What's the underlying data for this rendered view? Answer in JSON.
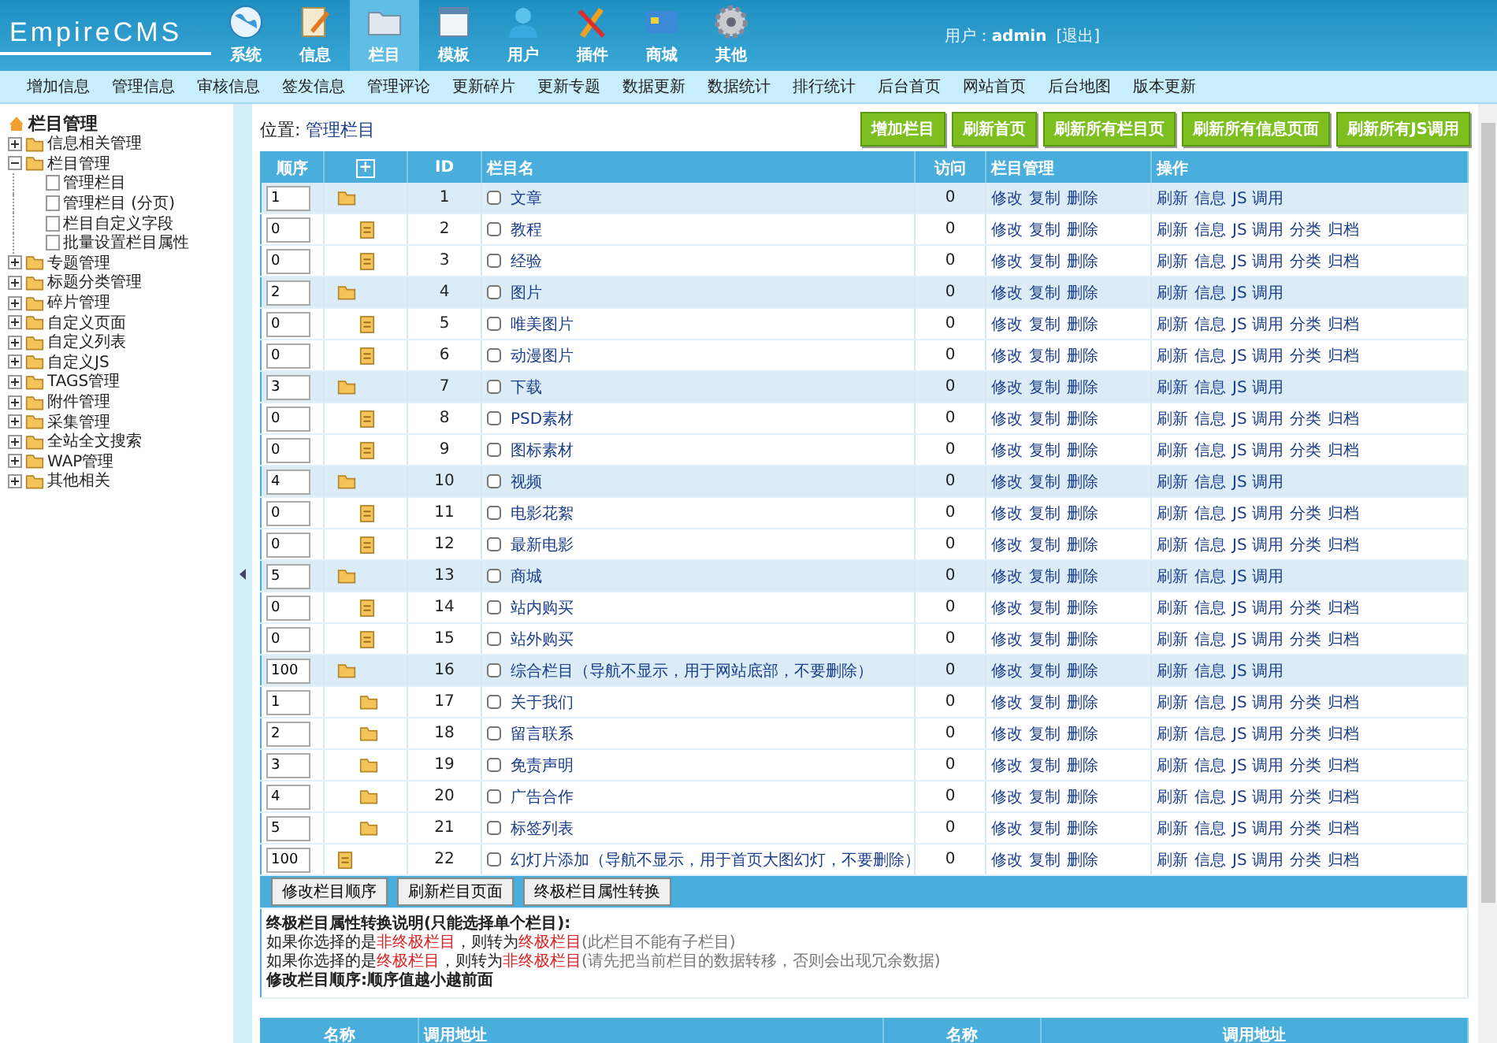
{
  "header": {
    "logo": "EmpireCMS",
    "nav": [
      {
        "label": "系统",
        "kind": "globe",
        "selected": false
      },
      {
        "label": "信息",
        "kind": "notepad",
        "selected": false
      },
      {
        "label": "栏目",
        "kind": "folder",
        "selected": true
      },
      {
        "label": "模板",
        "kind": "window",
        "selected": false
      },
      {
        "label": "用户",
        "kind": "user",
        "selected": false
      },
      {
        "label": "插件",
        "kind": "tools",
        "selected": false
      },
      {
        "label": "商城",
        "kind": "card",
        "selected": false
      },
      {
        "label": "其他",
        "kind": "gear",
        "selected": false
      }
    ],
    "user_label": "用户：",
    "user_name": "admin",
    "logout": "[退出]"
  },
  "menu": [
    "增加信息",
    "管理信息",
    "审核信息",
    "签发信息",
    "管理评论",
    "更新碎片",
    "更新专题",
    "数据更新",
    "数据统计",
    "排行统计",
    "后台首页",
    "网站首页",
    "后台地图",
    "版本更新"
  ],
  "sidebar": {
    "title": "栏目管理",
    "items": [
      {
        "label": "信息相关管理",
        "expanded": false
      },
      {
        "label": "栏目管理",
        "expanded": true,
        "children": [
          {
            "label": "管理栏目"
          },
          {
            "label": "管理栏目 (分页)"
          },
          {
            "label": "栏目自定义字段"
          },
          {
            "label": "批量设置栏目属性"
          }
        ]
      },
      {
        "label": "专题管理",
        "expanded": false
      },
      {
        "label": "标题分类管理",
        "expanded": false
      },
      {
        "label": "碎片管理",
        "expanded": false
      },
      {
        "label": "自定义页面",
        "expanded": false
      },
      {
        "label": "自定义列表",
        "expanded": false
      },
      {
        "label": "自定义JS",
        "expanded": false
      },
      {
        "label": "TAGS管理",
        "expanded": false
      },
      {
        "label": "附件管理",
        "expanded": false
      },
      {
        "label": "采集管理",
        "expanded": false
      },
      {
        "label": "全站全文搜索",
        "expanded": false
      },
      {
        "label": "WAP管理",
        "expanded": false
      },
      {
        "label": "其他相关",
        "expanded": false
      }
    ]
  },
  "breadcrumb": {
    "label": "位置:",
    "link": "管理栏目"
  },
  "toolbar": [
    "增加栏目",
    "刷新首页",
    "刷新所有栏目页",
    "刷新所有信息页面",
    "刷新所有JS调用"
  ],
  "table": {
    "columns": [
      "顺序",
      "+",
      "ID",
      "栏目名",
      "访问",
      "栏目管理",
      "操作"
    ],
    "rows": [
      {
        "order": "1",
        "kind": "folder",
        "id": "1",
        "checked": false,
        "name": "文章",
        "visits": "0",
        "manage": [
          "修改",
          "复制",
          "删除"
        ],
        "actions": [
          "刷新",
          "信息",
          "JS 调用"
        ]
      },
      {
        "order": "0",
        "kind": "doc",
        "id": "2",
        "checked": false,
        "name": "教程",
        "visits": "0",
        "manage": [
          "修改",
          "复制",
          "删除"
        ],
        "actions": [
          "刷新",
          "信息",
          "JS 调用",
          "分类",
          "归档"
        ]
      },
      {
        "order": "0",
        "kind": "doc",
        "id": "3",
        "checked": false,
        "name": "经验",
        "visits": "0",
        "manage": [
          "修改",
          "复制",
          "删除"
        ],
        "actions": [
          "刷新",
          "信息",
          "JS 调用",
          "分类",
          "归档"
        ]
      },
      {
        "order": "2",
        "kind": "folder",
        "id": "4",
        "checked": false,
        "name": "图片",
        "visits": "0",
        "manage": [
          "修改",
          "复制",
          "删除"
        ],
        "actions": [
          "刷新",
          "信息",
          "JS 调用"
        ]
      },
      {
        "order": "0",
        "kind": "doc",
        "id": "5",
        "checked": false,
        "name": "唯美图片",
        "visits": "0",
        "manage": [
          "修改",
          "复制",
          "删除"
        ],
        "actions": [
          "刷新",
          "信息",
          "JS 调用",
          "分类",
          "归档"
        ]
      },
      {
        "order": "0",
        "kind": "doc",
        "id": "6",
        "checked": false,
        "name": "动漫图片",
        "visits": "0",
        "manage": [
          "修改",
          "复制",
          "删除"
        ],
        "actions": [
          "刷新",
          "信息",
          "JS 调用",
          "分类",
          "归档"
        ]
      },
      {
        "order": "3",
        "kind": "folder",
        "id": "7",
        "checked": false,
        "name": "下载",
        "visits": "0",
        "manage": [
          "修改",
          "复制",
          "删除"
        ],
        "actions": [
          "刷新",
          "信息",
          "JS 调用"
        ]
      },
      {
        "order": "0",
        "kind": "doc",
        "id": "8",
        "checked": false,
        "name": "PSD素材",
        "visits": "0",
        "manage": [
          "修改",
          "复制",
          "删除"
        ],
        "actions": [
          "刷新",
          "信息",
          "JS 调用",
          "分类",
          "归档"
        ]
      },
      {
        "order": "0",
        "kind": "doc",
        "id": "9",
        "checked": false,
        "name": "图标素材",
        "visits": "0",
        "manage": [
          "修改",
          "复制",
          "删除"
        ],
        "actions": [
          "刷新",
          "信息",
          "JS 调用",
          "分类",
          "归档"
        ]
      },
      {
        "order": "4",
        "kind": "folder",
        "id": "10",
        "checked": false,
        "name": "视频",
        "visits": "0",
        "manage": [
          "修改",
          "复制",
          "删除"
        ],
        "actions": [
          "刷新",
          "信息",
          "JS 调用"
        ]
      },
      {
        "order": "0",
        "kind": "doc",
        "id": "11",
        "checked": false,
        "name": "电影花絮",
        "visits": "0",
        "manage": [
          "修改",
          "复制",
          "删除"
        ],
        "actions": [
          "刷新",
          "信息",
          "JS 调用",
          "分类",
          "归档"
        ]
      },
      {
        "order": "0",
        "kind": "doc",
        "id": "12",
        "checked": false,
        "name": "最新电影",
        "visits": "0",
        "manage": [
          "修改",
          "复制",
          "删除"
        ],
        "actions": [
          "刷新",
          "信息",
          "JS 调用",
          "分类",
          "归档"
        ]
      },
      {
        "order": "5",
        "kind": "folder",
        "id": "13",
        "checked": false,
        "name": "商城",
        "visits": "0",
        "manage": [
          "修改",
          "复制",
          "删除"
        ],
        "actions": [
          "刷新",
          "信息",
          "JS 调用"
        ]
      },
      {
        "order": "0",
        "kind": "doc",
        "id": "14",
        "checked": false,
        "name": "站内购买",
        "visits": "0",
        "manage": [
          "修改",
          "复制",
          "删除"
        ],
        "actions": [
          "刷新",
          "信息",
          "JS 调用",
          "分类",
          "归档"
        ]
      },
      {
        "order": "0",
        "kind": "doc",
        "id": "15",
        "checked": false,
        "name": "站外购买",
        "visits": "0",
        "manage": [
          "修改",
          "复制",
          "删除"
        ],
        "actions": [
          "刷新",
          "信息",
          "JS 调用",
          "分类",
          "归档"
        ]
      },
      {
        "order": "100",
        "kind": "folder",
        "id": "16",
        "checked": false,
        "name": "综合栏目（导航不显示，用于网站底部，不要删除）",
        "visits": "0",
        "manage": [
          "修改",
          "复制",
          "删除"
        ],
        "actions": [
          "刷新",
          "信息",
          "JS 调用"
        ]
      },
      {
        "order": "1",
        "kind": "subfolder",
        "id": "17",
        "checked": false,
        "name": "关于我们",
        "visits": "0",
        "manage": [
          "修改",
          "复制",
          "删除"
        ],
        "actions": [
          "刷新",
          "信息",
          "JS 调用",
          "分类",
          "归档"
        ]
      },
      {
        "order": "2",
        "kind": "subfolder",
        "id": "18",
        "checked": false,
        "name": "留言联系",
        "visits": "0",
        "manage": [
          "修改",
          "复制",
          "删除"
        ],
        "actions": [
          "刷新",
          "信息",
          "JS 调用",
          "分类",
          "归档"
        ]
      },
      {
        "order": "3",
        "kind": "subfolder",
        "id": "19",
        "checked": false,
        "name": "免责声明",
        "visits": "0",
        "manage": [
          "修改",
          "复制",
          "删除"
        ],
        "actions": [
          "刷新",
          "信息",
          "JS 调用",
          "分类",
          "归档"
        ]
      },
      {
        "order": "4",
        "kind": "subfolder",
        "id": "20",
        "checked": false,
        "name": "广告合作",
        "visits": "0",
        "manage": [
          "修改",
          "复制",
          "删除"
        ],
        "actions": [
          "刷新",
          "信息",
          "JS 调用",
          "分类",
          "归档"
        ]
      },
      {
        "order": "5",
        "kind": "subfolder",
        "id": "21",
        "checked": false,
        "name": "标签列表",
        "visits": "0",
        "manage": [
          "修改",
          "复制",
          "删除"
        ],
        "actions": [
          "刷新",
          "信息",
          "JS 调用",
          "分类",
          "归档"
        ]
      },
      {
        "order": "100",
        "kind": "rootdoc",
        "id": "22",
        "checked": false,
        "name": "幻灯片添加（导航不显示，用于首页大图幻灯，不要删除）",
        "visits": "0",
        "manage": [
          "修改",
          "复制",
          "删除"
        ],
        "actions": [
          "刷新",
          "信息",
          "JS 调用",
          "分类",
          "归档"
        ]
      }
    ],
    "buttons": [
      "修改栏目顺序",
      "刷新栏目页面",
      "终极栏目属性转换"
    ]
  },
  "notes": [
    [
      {
        "text": "终极栏目属性转换说明(只能选择单个栏目):",
        "kind": "bold"
      }
    ],
    [
      {
        "text": "如果你选择的是",
        "kind": "plain"
      },
      {
        "text": "非终极栏目",
        "kind": "red"
      },
      {
        "text": "，则转为",
        "kind": "plain"
      },
      {
        "text": "终极栏目",
        "kind": "red"
      },
      {
        "text": "(此栏目不能有子栏目)",
        "kind": "grey"
      }
    ],
    [
      {
        "text": "如果你选择的是",
        "kind": "plain"
      },
      {
        "text": "终极栏目",
        "kind": "red"
      },
      {
        "text": "，则转为",
        "kind": "plain"
      },
      {
        "text": "非终极栏目",
        "kind": "red"
      },
      {
        "text": "(请先把当前栏目的数据转移，否则会出现冗余数据)",
        "kind": "grey"
      }
    ],
    [
      {
        "text": "修改栏目顺序:顺序值越小越前面",
        "kind": "bold"
      }
    ]
  ],
  "bottom_table": {
    "columns": [
      "名称",
      "调用地址",
      "名称",
      "调用地址"
    ]
  }
}
